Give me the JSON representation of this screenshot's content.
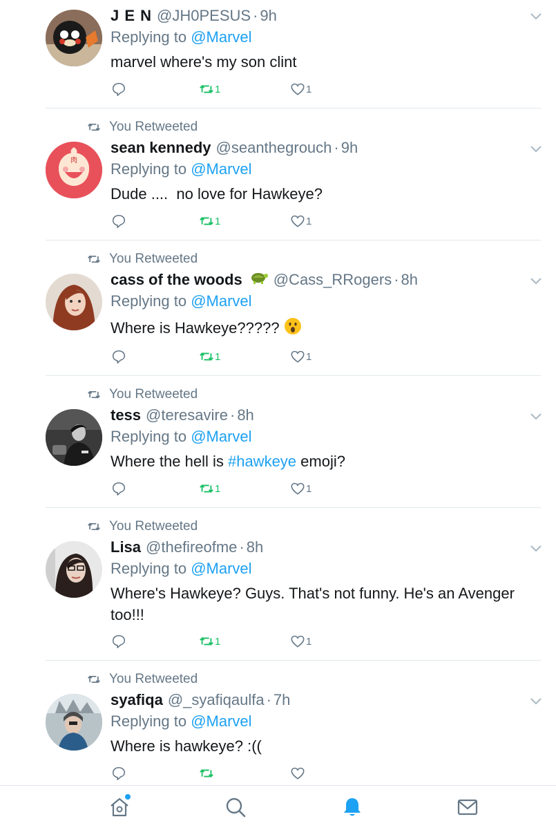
{
  "colors": {
    "accent": "#1da1f2",
    "retweet_green": "#17bf63",
    "secondary_text": "#657786",
    "divider": "#e1e8ed"
  },
  "tweets": [
    {
      "retweeted_label": "",
      "name": "J E N",
      "handle": "@JH0PESUS",
      "time": "9h",
      "replying_prefix": "Replying to",
      "replying_to": "@Marvel",
      "text_before": "marvel where's my son clint",
      "hashtag": "",
      "text_after": "",
      "retweets": "1",
      "likes": "1"
    },
    {
      "retweeted_label": "You Retweeted",
      "name": "sean kennedy",
      "handle": "@seanthegrouch",
      "time": "9h",
      "replying_prefix": "Replying to",
      "replying_to": "@Marvel",
      "text_before": "Dude ....  no love for Hawkeye?",
      "hashtag": "",
      "text_after": "",
      "retweets": "1",
      "likes": "1"
    },
    {
      "retweeted_label": "You Retweeted",
      "name": "cass of the woods",
      "handle": "@Cass_RRogers",
      "time": "8h",
      "replying_prefix": "Replying to",
      "replying_to": "@Marvel",
      "text_before": "Where is Hawkeye?????",
      "hashtag": "",
      "text_after": "",
      "retweets": "1",
      "likes": "1"
    },
    {
      "retweeted_label": "You Retweeted",
      "name": "tess",
      "handle": "@teresavire",
      "time": "8h",
      "replying_prefix": "Replying to",
      "replying_to": "@Marvel",
      "text_before": "Where the hell is ",
      "hashtag": "#hawkeye",
      "text_after": " emoji?",
      "retweets": "1",
      "likes": "1"
    },
    {
      "retweeted_label": "You Retweeted",
      "name": "Lisa",
      "handle": "@thefireofme",
      "time": "8h",
      "replying_prefix": "Replying to",
      "replying_to": "@Marvel",
      "text_before": "Where's Hawkeye? Guys. That's not funny. He's an Avenger too!!!",
      "hashtag": "",
      "text_after": "",
      "retweets": "1",
      "likes": "1"
    },
    {
      "retweeted_label": "You Retweeted",
      "name": "syafiqa",
      "handle": "@_syafiqaulfa",
      "time": "7h",
      "replying_prefix": "Replying to",
      "replying_to": "@Marvel",
      "text_before": "Where is hawkeye? :((",
      "hashtag": "",
      "text_after": "",
      "retweets": "",
      "likes": ""
    }
  ],
  "tabbar": {
    "items": [
      {
        "icon": "home-icon",
        "active": false,
        "badge": true
      },
      {
        "icon": "search-icon",
        "active": false,
        "badge": false
      },
      {
        "icon": "bell-icon",
        "active": true,
        "badge": false
      },
      {
        "icon": "mail-icon",
        "active": false,
        "badge": false
      }
    ]
  }
}
